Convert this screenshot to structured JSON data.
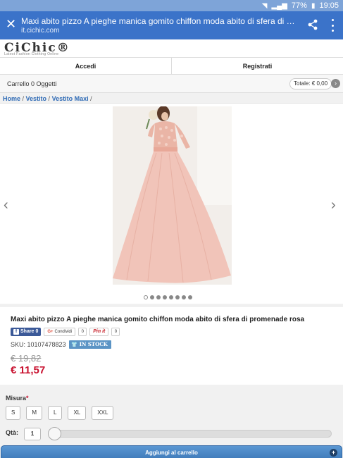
{
  "status_bar": {
    "battery": "77%",
    "time": "19:05"
  },
  "browser": {
    "page_title": "Maxi abito pizzo A pieghe manica gomito chiffon moda abito di sfera di promenade rosa",
    "url": "it.cichic.com",
    "close_icon": "close-icon",
    "share_icon": "share-icon",
    "menu_icon": "kebab-menu-icon"
  },
  "site": {
    "logo": "CiChic®",
    "tagline": "Latest Fashion Clothing Online"
  },
  "nav": {
    "login": "Accedi",
    "register": "Registrati"
  },
  "cart": {
    "label": "Carrello 0 Oggetti",
    "total": "Totale: € 0,00"
  },
  "breadcrumb": [
    "Home",
    "Vestito",
    "Vestito Maxi"
  ],
  "gallery": {
    "dot_count": 8,
    "active_dot": 0,
    "colors": {
      "dress": "#f1c4b9",
      "bg": "#f2eeea"
    }
  },
  "product": {
    "title": "Maxi abito pizzo A pieghe manica gomito chiffon moda abito di sfera di promenade rosa",
    "share_fb": "Share",
    "share_fb_count": "0",
    "share_gp": "Condividi",
    "share_gp_count": "0",
    "pin_label": "Pin it",
    "pin_count": "0",
    "sku": "SKU: 10107478823",
    "stock": "IN STOCK",
    "old_price": "€ 19,82",
    "new_price": "€ 11,57"
  },
  "options": {
    "size_label": "Misura",
    "required_mark": "*",
    "sizes": [
      "S",
      "M",
      "L",
      "XL",
      "XXL"
    ],
    "qty_label": "Qtà:",
    "qty_value": "1",
    "add_to_cart": "Aggiungi al carrello"
  }
}
